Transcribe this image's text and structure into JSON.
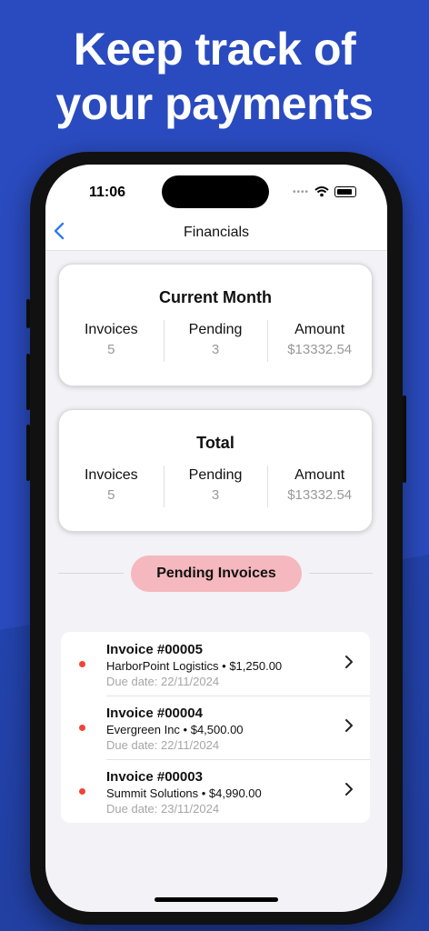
{
  "promo": {
    "headline_line1": "Keep track of",
    "headline_line2": "your payments"
  },
  "status_bar": {
    "time": "11:06"
  },
  "navbar": {
    "back_icon": "chevron-left-icon",
    "title": "Financials"
  },
  "current_month": {
    "title": "Current Month",
    "invoices_label": "Invoices",
    "invoices_value": "5",
    "pending_label": "Pending",
    "pending_value": "3",
    "amount_label": "Amount",
    "amount_value": "$13332.54"
  },
  "total": {
    "title": "Total",
    "invoices_label": "Invoices",
    "invoices_value": "5",
    "pending_label": "Pending",
    "pending_value": "3",
    "amount_label": "Amount",
    "amount_value": "$13332.54"
  },
  "pending_section": {
    "label": "Pending Invoices"
  },
  "invoices": [
    {
      "title": "Invoice #00005",
      "client_amount": "HarborPoint Logistics • $1,250.00",
      "due": "Due date: 22/11/2024"
    },
    {
      "title": "Invoice #00004",
      "client_amount": "Evergreen Inc • $4,500.00",
      "due": "Due date: 22/11/2024"
    },
    {
      "title": "Invoice #00003",
      "client_amount": "Summit Solutions • $4,990.00",
      "due": "Due date: 23/11/2024"
    }
  ],
  "colors": {
    "background": "#2a4bbf",
    "pill": "#f5b8be",
    "status_dot": "#f0443a",
    "accent": "#2f7cf6"
  }
}
